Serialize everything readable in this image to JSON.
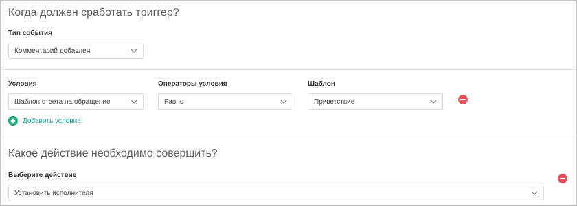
{
  "trigger": {
    "title": "Когда должен сработать триггер?",
    "event_type": {
      "label": "Тип события",
      "value": "Комментарий добавлен"
    }
  },
  "conditions": {
    "condition_label": "Условия",
    "operator_label": "Операторы условия",
    "template_label": "Шаблон",
    "rows": [
      {
        "condition": "Шаблон ответа на обращение",
        "operator": "Равно",
        "template": "Приветствие"
      }
    ],
    "add_label": "Добавить условие"
  },
  "action": {
    "title": "Какое действие необходимо совершить?",
    "select_label": "Выберите действие",
    "value": "Установить исполнителя"
  },
  "colors": {
    "remove": "#e5525a",
    "add": "#1eaa7e",
    "link": "#20a9a0"
  },
  "icons": {
    "chevron": "chevron-down-icon",
    "remove": "remove-circle-icon",
    "add": "add-circle-icon"
  }
}
